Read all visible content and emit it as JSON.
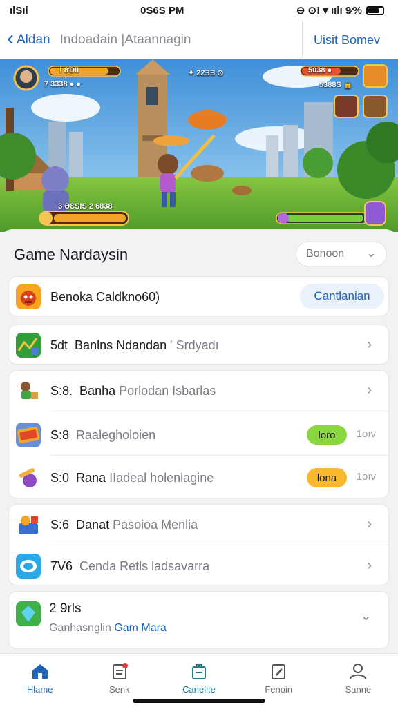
{
  "status_bar": {
    "carrier": "ılSıl",
    "time": "0S6S PM",
    "right": "⊖ ⊙ǃ ▾ ıılı 9⁄% "
  },
  "nav": {
    "back_label": "Aldan",
    "title": "Indoadain |Ataannagin",
    "right_action": "Uisit Bomev"
  },
  "banner": {
    "hud_top_left": "ǃ 8ƊƖƖ",
    "hud_top_left_2": "7 3338 ● ●",
    "hud_center": "✦ 22ƎƎ ⊙",
    "hud_top_right": "5038 ●",
    "hud_top_right_2": "5388S 🔒",
    "hud_bottom_left": "3 ƏƐSIS 2 6838",
    "accent_health": "#f3a329",
    "accent_mana": "#7ad03a"
  },
  "sheet": {
    "title": "Game Nardaysin",
    "dropdown_value": "Bonoon"
  },
  "primary_item": {
    "label": "Benoka Caldkno60)",
    "button": "Cantlanian",
    "icon": "monster-icon"
  },
  "list": [
    {
      "id": "item-1",
      "prefix": "5dt",
      "title": "Banlns Ndandan",
      "subtitle": "' Srdyadı",
      "icon": "map-icon",
      "trailing": "chevron"
    },
    {
      "id": "item-2",
      "prefix": "S:8.",
      "title": "Banha",
      "subtitle": "Porlodan Isbarlas",
      "icon": "adventurer-icon",
      "trailing": "chevron"
    },
    {
      "id": "item-3",
      "prefix": "S:8",
      "title": "",
      "subtitle": "Raalegholoien",
      "icon": "tickets-icon",
      "trailing": "pill",
      "pill": "loro",
      "pill_color": "#8ad63f",
      "meta": "1oıv"
    },
    {
      "id": "item-4",
      "prefix": "S:0",
      "title": "Rana",
      "subtitle": "IIadeal holenlagine",
      "icon": "potion-icon",
      "trailing": "pill",
      "pill": "lona",
      "pill_color": "#f9b82e",
      "meta": "1oıv"
    },
    {
      "id": "item-5",
      "prefix": "S:6",
      "title": "Danat",
      "subtitle": "Pasoioa Menlia",
      "icon": "toybox-icon",
      "trailing": "chevron"
    },
    {
      "id": "item-6",
      "prefix": "7V6",
      "title": "",
      "subtitle": "Cenda Retls ladsavarra",
      "icon": "bubble-icon",
      "trailing": "chevron"
    }
  ],
  "group_item": {
    "title": "2 9rls",
    "subtitle_gray": "Ganhasnglin",
    "subtitle_blue": "Gam Mara",
    "icon": "gem-icon"
  },
  "tabs": [
    {
      "label": "Hlame",
      "icon": "home-icon",
      "active": true
    },
    {
      "label": "Senk",
      "icon": "document-icon"
    },
    {
      "label": "Canelite",
      "icon": "bag-icon"
    },
    {
      "label": "Fenoin",
      "icon": "edit-icon"
    },
    {
      "label": "Sanne",
      "icon": "profile-icon"
    }
  ]
}
